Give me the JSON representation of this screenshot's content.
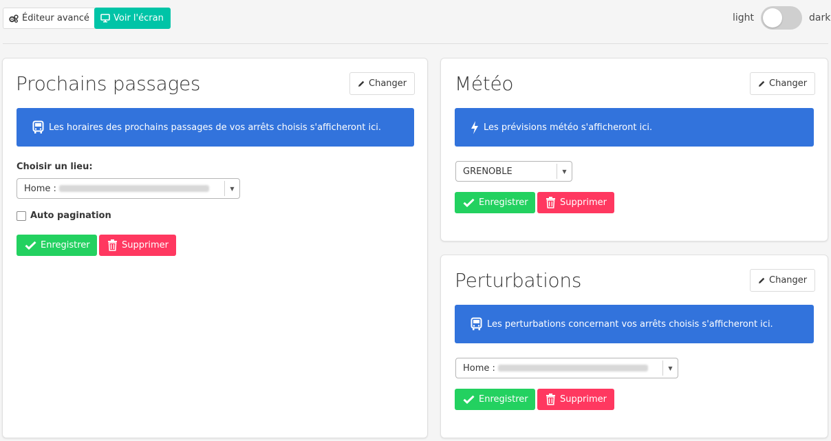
{
  "toolbar": {
    "editor_label": "Éditeur avancé",
    "view_label": "Voir l'écran",
    "theme_light": "light",
    "theme_dark": "dark"
  },
  "passages": {
    "title": "Prochains passages",
    "change_label": "Changer",
    "notice": "Les horaires des prochains passages de vos arrêts choisis s'afficheront ici.",
    "place_label": "Choisir un lieu:",
    "place_value_prefix": "Home :",
    "auto_pagination_label": "Auto pagination",
    "save_label": "Enregistrer",
    "delete_label": "Supprimer"
  },
  "meteo": {
    "title": "Météo",
    "change_label": "Changer",
    "notice": "Les prévisions météo s'afficheront ici.",
    "city_value": "GRENOBLE",
    "save_label": "Enregistrer",
    "delete_label": "Supprimer"
  },
  "perturbations": {
    "title": "Perturbations",
    "change_label": "Changer",
    "notice": "Les perturbations concernant vos arrêts choisis s'afficheront ici.",
    "place_value_prefix": "Home :",
    "save_label": "Enregistrer",
    "delete_label": "Supprimer"
  },
  "colors": {
    "primary": "#00c4a7",
    "info": "#3273dc",
    "success": "#23d160",
    "danger": "#ff3860"
  },
  "icons": {
    "editor": "cogs-icon",
    "view": "desktop-icon",
    "change": "pencil-icon",
    "bus": "bus-icon",
    "weather": "bolt-icon",
    "save": "check-icon",
    "delete": "trash-icon"
  }
}
